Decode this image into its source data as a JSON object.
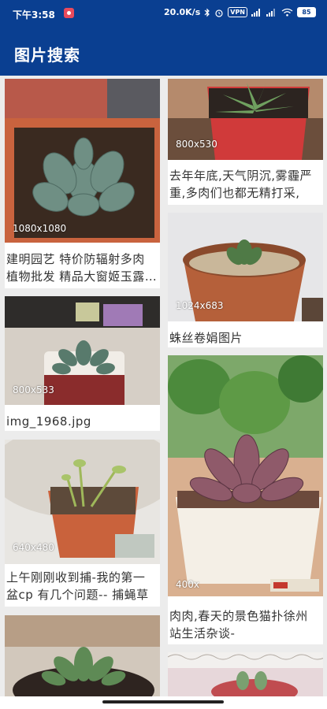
{
  "status_bar": {
    "time": "下午3:58",
    "speed": "20.0K/s",
    "vpn": "VPN",
    "battery": "85"
  },
  "app_bar": {
    "title": "图片搜索"
  },
  "left_column": [
    {
      "dim": "1080x1080",
      "caption": "建明园艺 特价防辐射多肉植物批发 精品大窗姬玉露 中号肉肉"
    },
    {
      "dim": "800x533",
      "caption": "img_1968.jpg"
    },
    {
      "dim": "640x480",
      "caption": "上午刚刚收到捕-我的第一盆cp 有几个问题-- 捕蝇草"
    },
    {
      "dim": "",
      "caption": ""
    }
  ],
  "right_column": [
    {
      "dim": "800x530",
      "caption": "去年年底,天气阴沉,雾霾严重,多肉们也都无精打采,"
    },
    {
      "dim": "1024x683",
      "caption": "蛛丝卷娟图片"
    },
    {
      "dim": "400x",
      "caption": "肉肉,春天的景色猫扑徐州站生活杂谈-"
    },
    {
      "dim": "",
      "caption": ""
    }
  ]
}
